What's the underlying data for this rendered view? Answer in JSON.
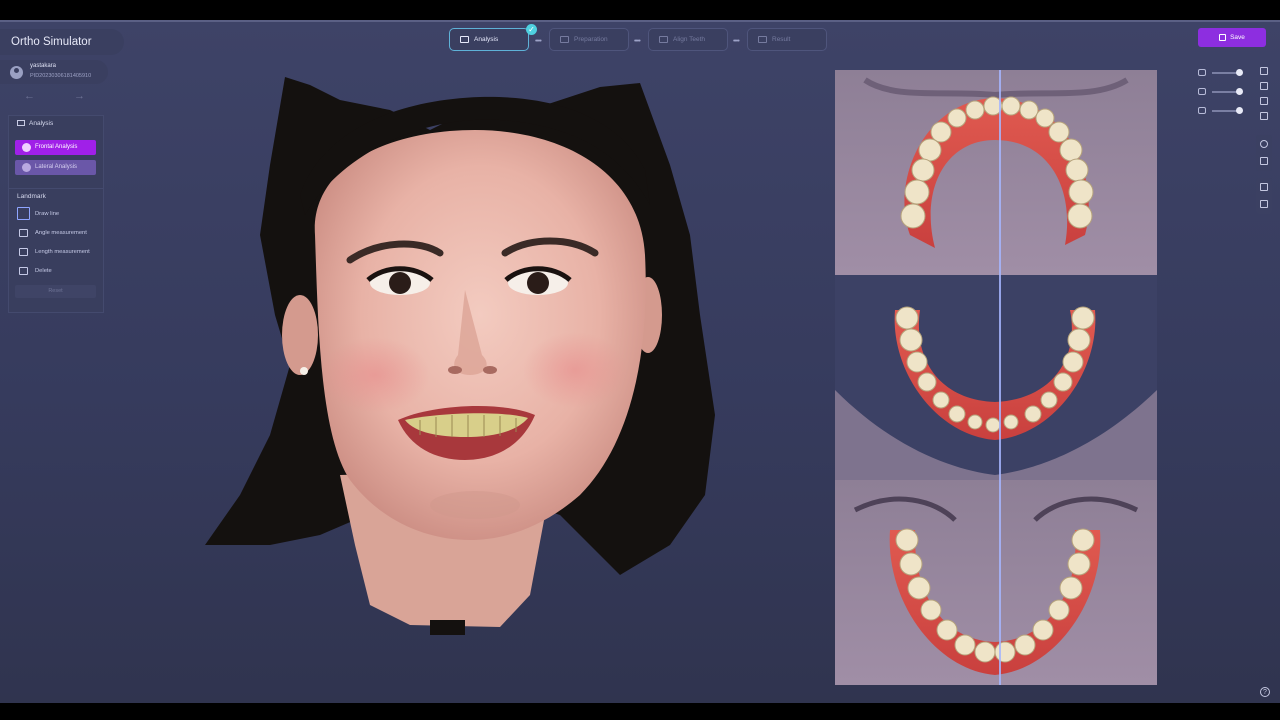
{
  "app": {
    "title": "Ortho Simulator",
    "user_name": "yastakara",
    "patient_id": "PID20230306181405910"
  },
  "nav": {
    "back_icon": "arrow-left-icon",
    "forward_icon": "arrow-right-icon"
  },
  "analysis_panel": {
    "title": "Analysis",
    "frontal_label": "Frontal Analysis",
    "lateral_label": "Lateral Analysis"
  },
  "landmark_panel": {
    "title": "Landmark",
    "tools": [
      "Draw line",
      "Angle measurement",
      "Length measurement",
      "Delete"
    ],
    "reset_label": "Reset"
  },
  "steps": [
    {
      "label": "Analysis",
      "state": "active",
      "icon": "analysis-icon"
    },
    {
      "label": "Preparation",
      "state": "inactive",
      "icon": "preparation-icon"
    },
    {
      "label": "Align Teeth",
      "state": "inactive",
      "icon": "align-teeth-icon"
    },
    {
      "label": "Result",
      "state": "inactive",
      "icon": "result-icon"
    }
  ],
  "save_label": "Save",
  "colors": {
    "accent": "#8d2ee0",
    "active_button": "#a020e8",
    "step_active_border": "#5fb2d8",
    "check": "#4fd0e0"
  },
  "opacity_sliders": [
    {
      "icon": "face-opacity-icon",
      "level": 1.0
    },
    {
      "icon": "upper-jaw-opacity-icon",
      "level": 1.0
    },
    {
      "icon": "lower-jaw-opacity-icon",
      "level": 1.0
    }
  ]
}
